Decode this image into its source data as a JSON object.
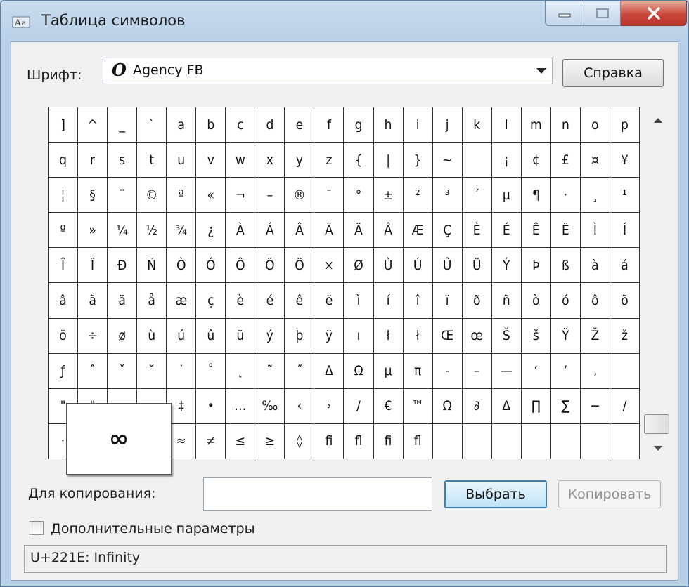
{
  "window": {
    "title": "Таблица символов",
    "accent": "#3c7fb1",
    "close_color": "#c8473a"
  },
  "font_picker": {
    "label": "Шрифт:",
    "icon": "opentype-icon",
    "glyph": "O",
    "value": "Agency FB"
  },
  "help_button": {
    "label": "Справка"
  },
  "grid_rows": [
    [
      "]",
      "^",
      "_",
      "`",
      "a",
      "b",
      "c",
      "d",
      "e",
      "f",
      "g",
      "h",
      "i",
      "j",
      "k",
      "l",
      "m",
      "n",
      "o",
      "p"
    ],
    [
      "q",
      "r",
      "s",
      "t",
      "u",
      "v",
      "w",
      "x",
      "y",
      "z",
      "{",
      "|",
      "}",
      "~",
      "",
      "¡",
      "¢",
      "£",
      "¤",
      "¥"
    ],
    [
      "¦",
      "§",
      "¨",
      "©",
      "ª",
      "«",
      "¬",
      "–",
      "®",
      "¯",
      "°",
      "±",
      "²",
      "³",
      "´",
      "µ",
      "¶",
      "·",
      "¸",
      "¹"
    ],
    [
      "º",
      "»",
      "¼",
      "½",
      "¾",
      "¿",
      "À",
      "Á",
      "Â",
      "Ã",
      "Ä",
      "Å",
      "Æ",
      "Ç",
      "È",
      "É",
      "Ê",
      "Ë",
      "Ì",
      "Í"
    ],
    [
      "Î",
      "Ï",
      "Ð",
      "Ñ",
      "Ò",
      "Ó",
      "Ô",
      "Õ",
      "Ö",
      "×",
      "Ø",
      "Ù",
      "Ú",
      "Û",
      "Ü",
      "Ý",
      "Þ",
      "ß",
      "à",
      "á"
    ],
    [
      "â",
      "ã",
      "ä",
      "å",
      "æ",
      "ç",
      "è",
      "é",
      "ê",
      "ë",
      "ì",
      "í",
      "î",
      "ï",
      "ð",
      "ñ",
      "ò",
      "ó",
      "ô",
      "õ"
    ],
    [
      "ö",
      "÷",
      "ø",
      "ù",
      "ú",
      "û",
      "ü",
      "ý",
      "þ",
      "ÿ",
      "ı",
      "ł",
      "ł",
      "Œ",
      "œ",
      "Š",
      "š",
      "Ÿ",
      "Ž",
      "ž"
    ],
    [
      "ƒ",
      "ˆ",
      "ˇ",
      "˘",
      "˙",
      "˚",
      "˛",
      "˜",
      "˝",
      "Δ",
      "Ω",
      "μ",
      "π",
      "-",
      "–",
      "—",
      "‘",
      "’",
      "‚",
      ""
    ],
    [
      "\"",
      "\"",
      "",
      "",
      "‡",
      "•",
      "…",
      "‰",
      "‹",
      "›",
      "/",
      "€",
      "™",
      "Ω",
      "∂",
      "∆",
      "∏",
      "∑",
      "−",
      "∕"
    ],
    [
      "·",
      "",
      "",
      "",
      "≈",
      "≠",
      "≤",
      "≥",
      "◊",
      "ﬁ",
      "ﬂ",
      "ﬁ",
      "ﬂ",
      "",
      "",
      "",
      "",
      "",
      "",
      ""
    ]
  ],
  "preview": {
    "symbol": "∞"
  },
  "copy_section": {
    "label": "Для копирования:",
    "value": "",
    "select_label": "Выбрать",
    "copy_label": "Копировать"
  },
  "advanced": {
    "label": "Дополнительные параметры",
    "checked": false
  },
  "status_bar": {
    "text": "U+221E: Infinity"
  }
}
